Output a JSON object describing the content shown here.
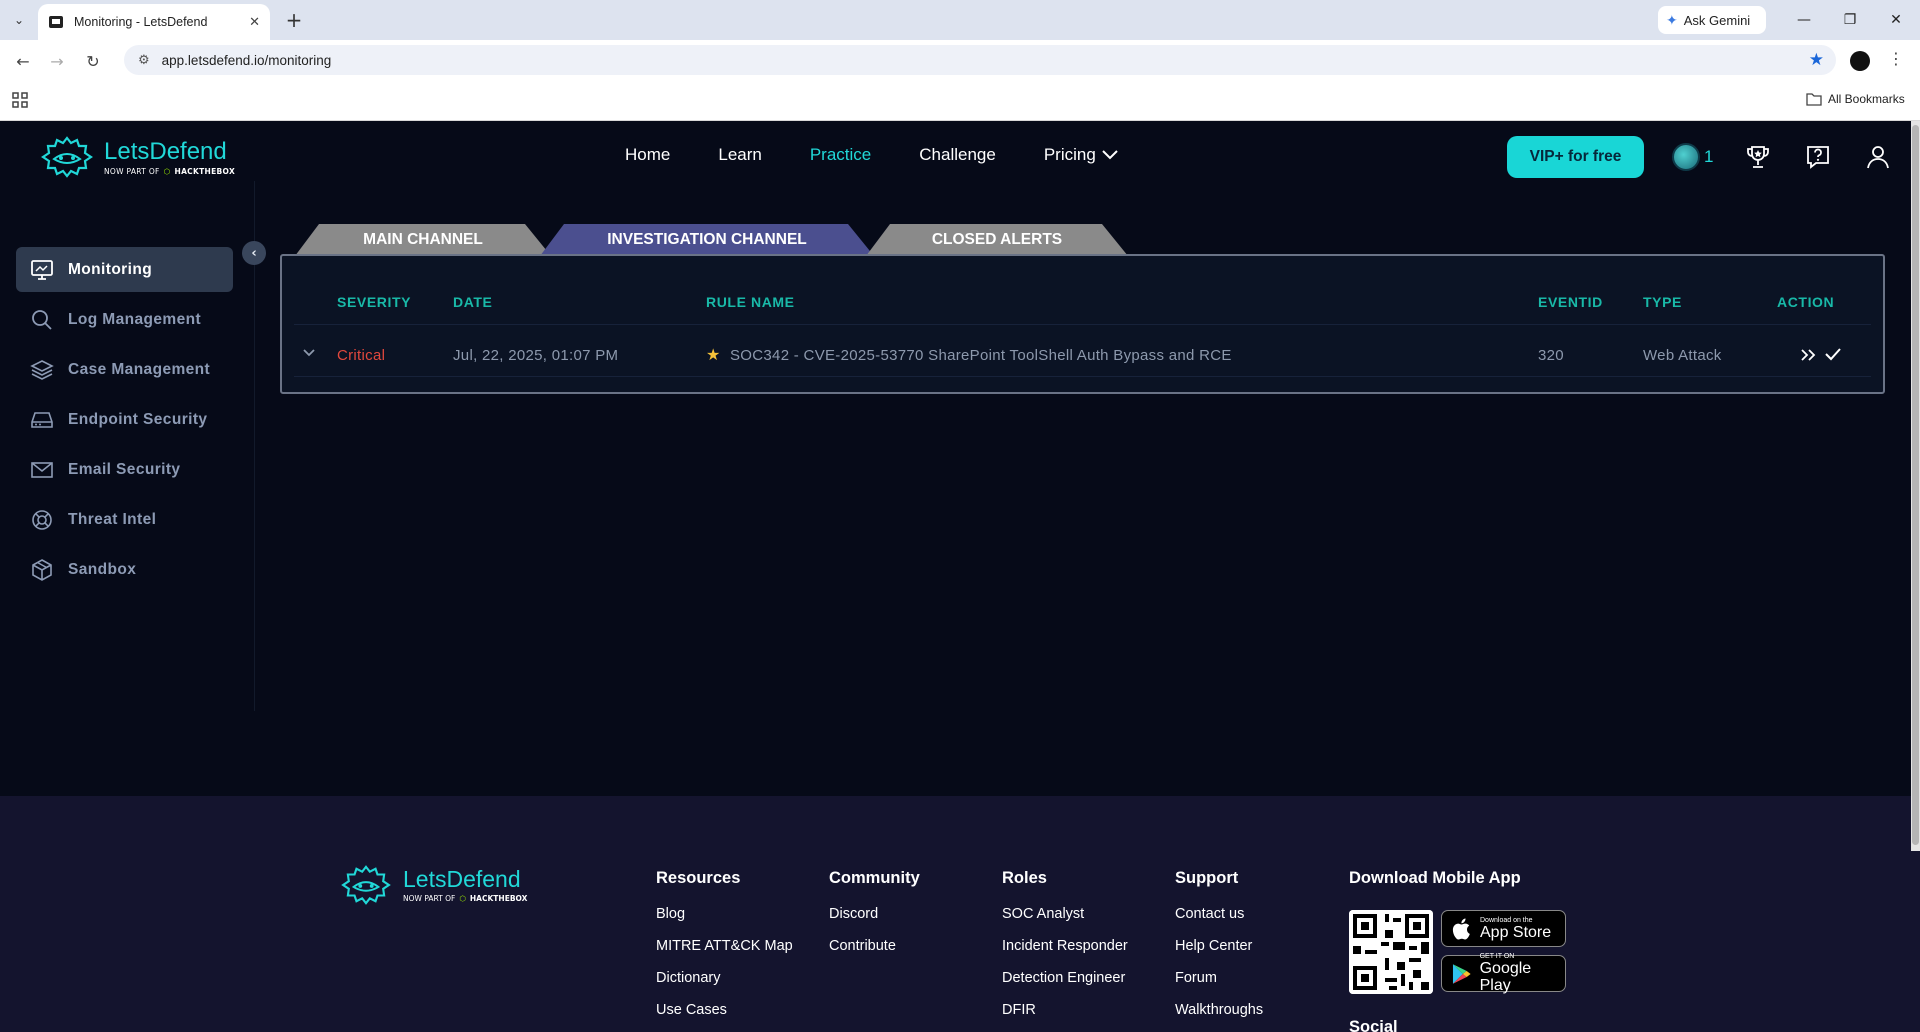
{
  "browser": {
    "tab_title": "Monitoring - LetsDefend",
    "url": "app.letsdefend.io/monitoring",
    "gemini_label": "Ask Gemini",
    "all_bookmarks": "All Bookmarks"
  },
  "brand": {
    "name": "LetsDefend",
    "sub_prefix": "NOW PART OF",
    "sub_partner": "HACKTHEBOX"
  },
  "topnav": {
    "home": "Home",
    "learn": "Learn",
    "practice": "Practice",
    "challenge": "Challenge",
    "pricing": "Pricing"
  },
  "header": {
    "vip_label": "VIP+ for free",
    "streak_count": "1"
  },
  "sidebar": {
    "items": [
      {
        "label": "Monitoring",
        "icon": "monitor-icon"
      },
      {
        "label": "Log Management",
        "icon": "search-icon"
      },
      {
        "label": "Case Management",
        "icon": "layers-icon"
      },
      {
        "label": "Endpoint Security",
        "icon": "drive-icon"
      },
      {
        "label": "Email Security",
        "icon": "mail-icon"
      },
      {
        "label": "Threat Intel",
        "icon": "lifebuoy-icon"
      },
      {
        "label": "Sandbox",
        "icon": "cube-icon"
      }
    ]
  },
  "channels": {
    "main": "MAIN CHANNEL",
    "investigation": "INVESTIGATION CHANNEL",
    "closed": "CLOSED ALERTS"
  },
  "table": {
    "headers": {
      "severity": "SEVERITY",
      "date": "DATE",
      "rule_name": "RULE NAME",
      "eventid": "EVENTID",
      "type": "TYPE",
      "action": "ACTION"
    },
    "rows": [
      {
        "severity": "Critical",
        "date": "Jul, 22, 2025, 01:07 PM",
        "rule_name": "SOC342 - CVE-2025-53770 SharePoint ToolShell Auth Bypass and RCE",
        "eventid": "320",
        "type": "Web Attack"
      }
    ]
  },
  "footer": {
    "resources": {
      "title": "Resources",
      "links": [
        "Blog",
        "MITRE ATT&CK Map",
        "Dictionary",
        "Use Cases"
      ]
    },
    "community": {
      "title": "Community",
      "links": [
        "Discord",
        "Contribute"
      ]
    },
    "roles": {
      "title": "Roles",
      "links": [
        "SOC Analyst",
        "Incident Responder",
        "Detection Engineer",
        "DFIR"
      ]
    },
    "support": {
      "title": "Support",
      "links": [
        "Contact us",
        "Help Center",
        "Forum",
        "Walkthroughs"
      ]
    },
    "app": {
      "title": "Download Mobile App",
      "appstore_small": "Download on the",
      "appstore_big": "App Store",
      "play_small": "GET IT ON",
      "play_big": "Google Play"
    },
    "social_title": "Social"
  },
  "colors": {
    "accent": "#21d8d8",
    "critical": "#e2483d",
    "investigation_tab": "#4b4f8f",
    "inactive_tab": "#8a8a8a"
  }
}
